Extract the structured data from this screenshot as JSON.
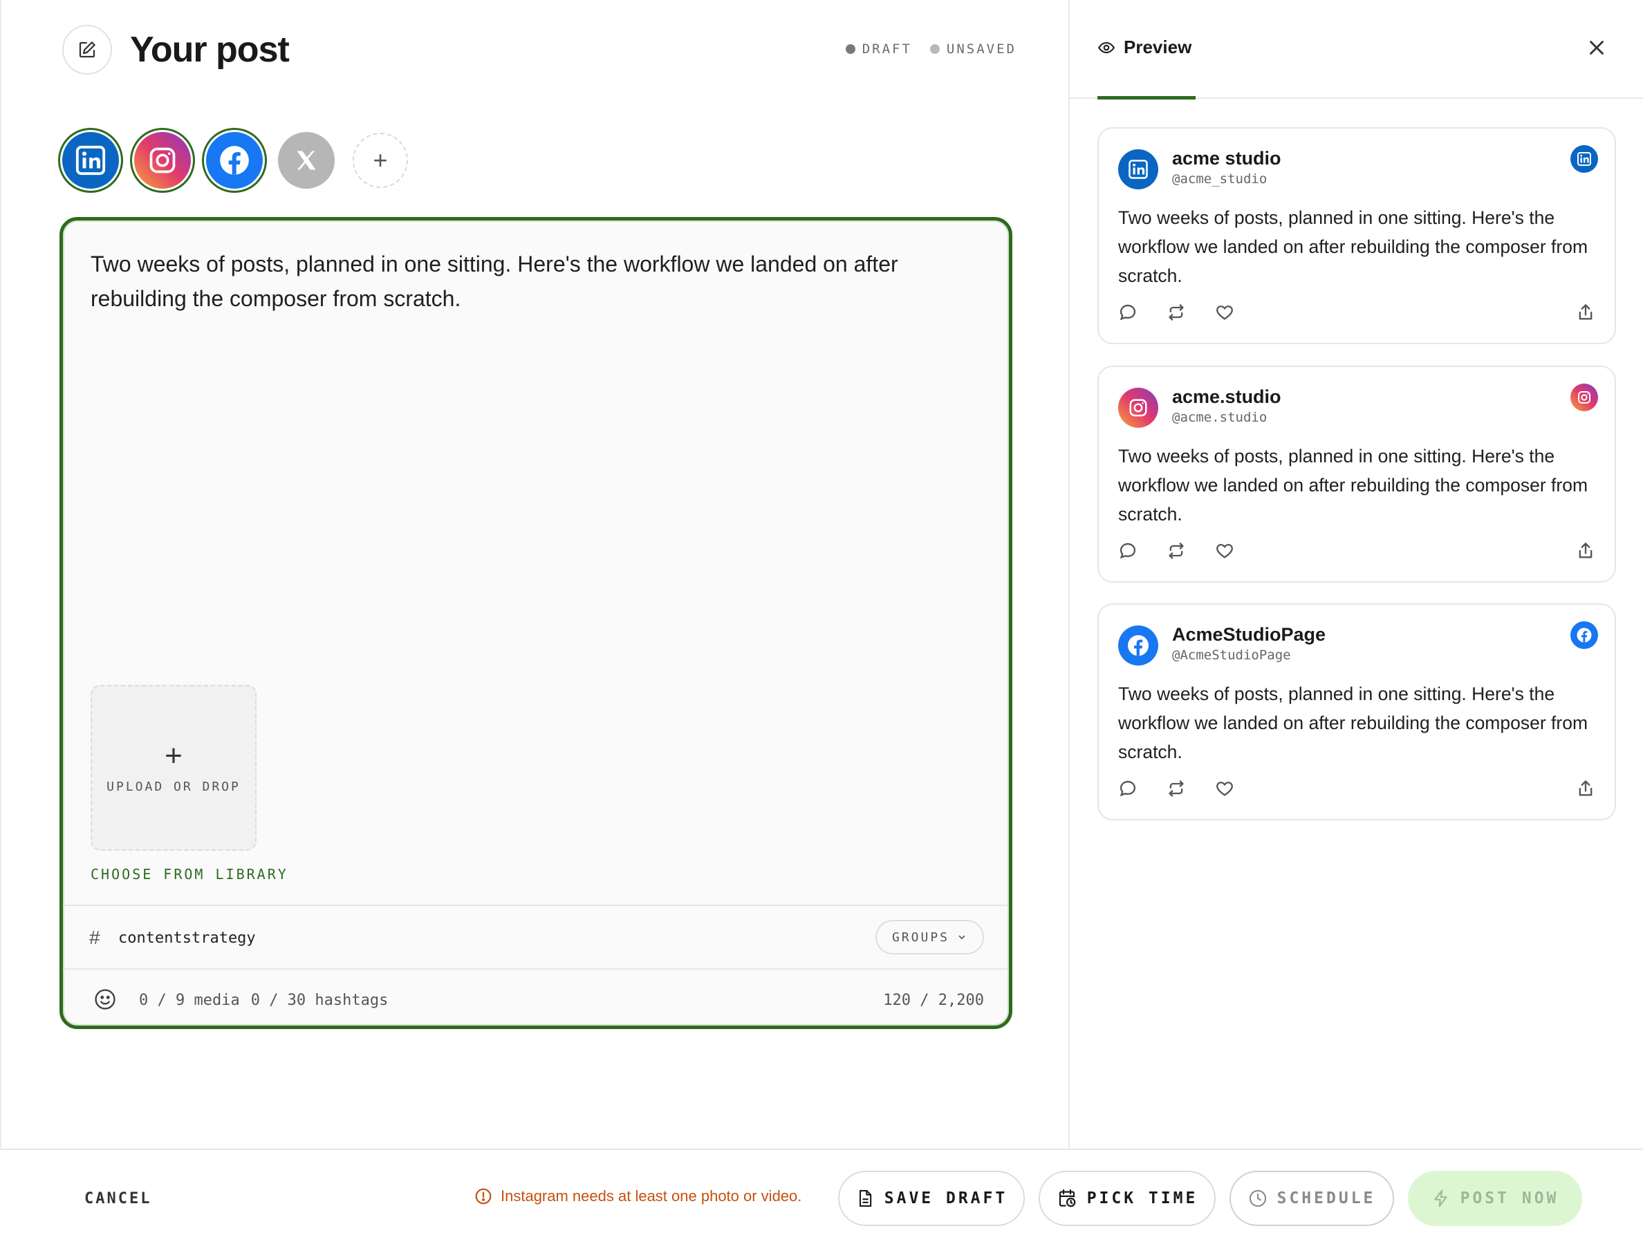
{
  "header": {
    "title": "Your post",
    "status": [
      {
        "label": "DRAFT",
        "color": "#7a7a7a"
      },
      {
        "label": "UNSAVED",
        "color": "#b9b9b9"
      }
    ]
  },
  "channels": [
    {
      "name": "LinkedIn",
      "icon": "linkedin-icon",
      "selected": true,
      "color": "#0a66c2"
    },
    {
      "name": "Instagram",
      "icon": "instagram-icon",
      "selected": true,
      "color": "#d6336c"
    },
    {
      "name": "Facebook",
      "icon": "facebook-icon",
      "selected": true,
      "color": "#1877f2"
    },
    {
      "name": "X",
      "icon": "x-icon",
      "selected": false,
      "color": "#b6b6b6"
    }
  ],
  "editor": {
    "text": "Two weeks of posts, planned in one sitting. Here's the workflow we landed on after rebuilding the composer from scratch.",
    "upload_label": "UPLOAD OR DROP",
    "library_link": "CHOOSE FROM LIBRARY",
    "hashtag": "contentstrategy",
    "groups_label": "GROUPS",
    "media_count": "0 / 9 media",
    "hashtag_count": "0 / 30 hashtags",
    "char_count": "120 / 2,200"
  },
  "preview": {
    "tab_label": "Preview",
    "cards": [
      {
        "name": "acme studio",
        "handle": "@acme_studio",
        "network": "linkedin",
        "text": "Two weeks of posts, planned in one sitting. Here's the workflow we landed on after rebuilding the composer from scratch."
      },
      {
        "name": "acme.studio",
        "handle": "@acme.studio",
        "network": "instagram",
        "text": "Two weeks of posts, planned in one sitting. Here's the workflow we landed on after rebuilding the composer from scratch."
      },
      {
        "name": "AcmeStudioPage",
        "handle": "@AcmeStudioPage",
        "network": "facebook",
        "text": "Two weeks of posts, planned in one sitting. Here's the workflow we landed on after rebuilding the composer from scratch."
      }
    ]
  },
  "footer": {
    "cancel": "CANCEL",
    "warning": "Instagram needs at least one photo or video.",
    "save_draft": "SAVE DRAFT",
    "pick_time": "PICK TIME",
    "schedule": "SCHEDULE",
    "post_now": "POST NOW",
    "accent": "#2f6a1f",
    "warning_color": "#c4510e"
  }
}
